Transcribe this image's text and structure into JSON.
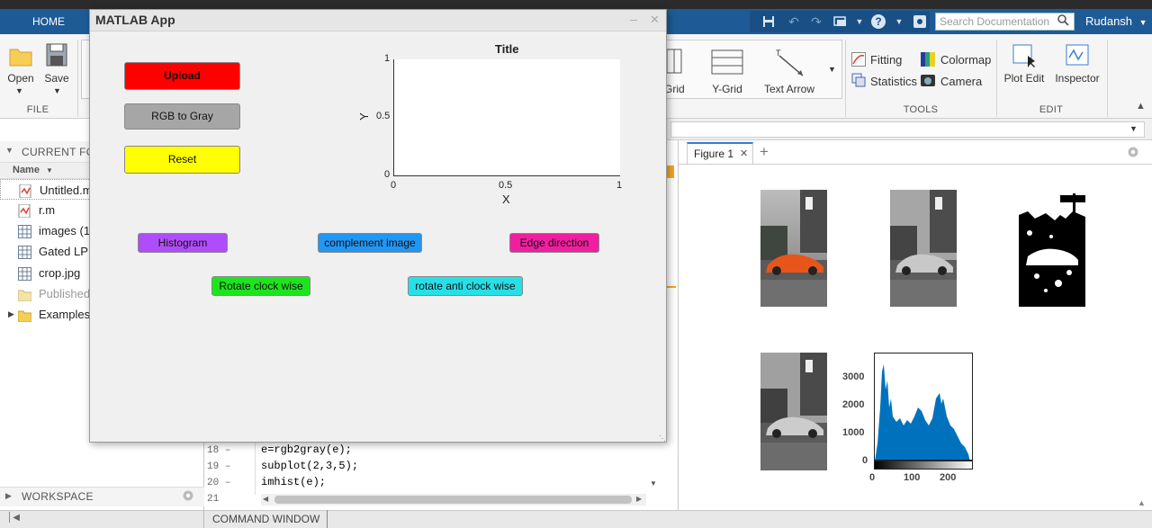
{
  "tabs": {
    "home": "HOME"
  },
  "search": {
    "placeholder": "Search Documentation"
  },
  "user": {
    "name": "Rudansh"
  },
  "ribbon": {
    "file": {
      "open": "Open",
      "save": "Save",
      "section": "FILE"
    },
    "plot_items": {
      "grid": "Grid",
      "ygrid": "Y-Grid",
      "text_arrow": "Text Arrow"
    },
    "tools": {
      "fitting": "Fitting",
      "statistics": "Statistics",
      "colormap": "Colormap",
      "camera": "Camera",
      "section": "TOOLS"
    },
    "edit": {
      "plot_edit": "Plot Edit",
      "inspector": "Inspector",
      "section": "EDIT"
    }
  },
  "current_folder": {
    "title": "CURRENT FO",
    "column_name": "Name",
    "items": [
      {
        "label": "Untitled.m",
        "icon": "m-file-icon"
      },
      {
        "label": "r.m",
        "icon": "m-file-icon"
      },
      {
        "label": "images (1",
        "icon": "grid-file-icon"
      },
      {
        "label": "Gated LP",
        "icon": "grid-file-icon"
      },
      {
        "label": "crop.jpg",
        "icon": "grid-file-icon"
      },
      {
        "label": "Published",
        "icon": "folder-icon"
      },
      {
        "label": "Examples",
        "icon": "folder-icon"
      }
    ]
  },
  "workspace": {
    "title": "WORKSPACE"
  },
  "command_window": {
    "label": "COMMAND WINDOW"
  },
  "editor": {
    "lines": [
      {
        "num": "18",
        "marker": "–",
        "code": "e=rgb2gray(e);"
      },
      {
        "num": "19",
        "marker": "–",
        "code": "subplot(2,3,5);"
      },
      {
        "num": "20",
        "marker": "–",
        "code": "imhist(e);"
      },
      {
        "num": "21",
        "marker": "",
        "code": ""
      }
    ]
  },
  "figure": {
    "tab_label": "Figure 1",
    "add_tab": "+",
    "hist_y_ticks": [
      "3000",
      "2000",
      "1000",
      "0"
    ],
    "hist_x_ticks": [
      "0",
      "100",
      "200"
    ]
  },
  "app": {
    "title": "MATLAB App",
    "buttons": {
      "upload": {
        "label": "Upload",
        "color": "#ff0000"
      },
      "rgb_to_gray": {
        "label": "RGB to Gray",
        "color": "#a6a6a6"
      },
      "reset": {
        "label": "Reset",
        "color": "#ffff00"
      },
      "histogram": {
        "label": "Histogram",
        "color": "#b04dfa"
      },
      "complement": {
        "label": "complement image",
        "color": "#2196f3"
      },
      "edge": {
        "label": "Edge direction",
        "color": "#f01fa0"
      },
      "rotate_cw": {
        "label": "Rotate clock wise",
        "color": "#1de51d"
      },
      "rotate_acw": {
        "label": "rotate anti clock wise",
        "color": "#26e0e8"
      }
    },
    "axes": {
      "title": "Title",
      "xlabel": "X",
      "ylabel": "Y",
      "x_ticks": [
        "0",
        "0.5",
        "1"
      ],
      "y_ticks": [
        "1",
        "0.5",
        "0"
      ]
    }
  }
}
